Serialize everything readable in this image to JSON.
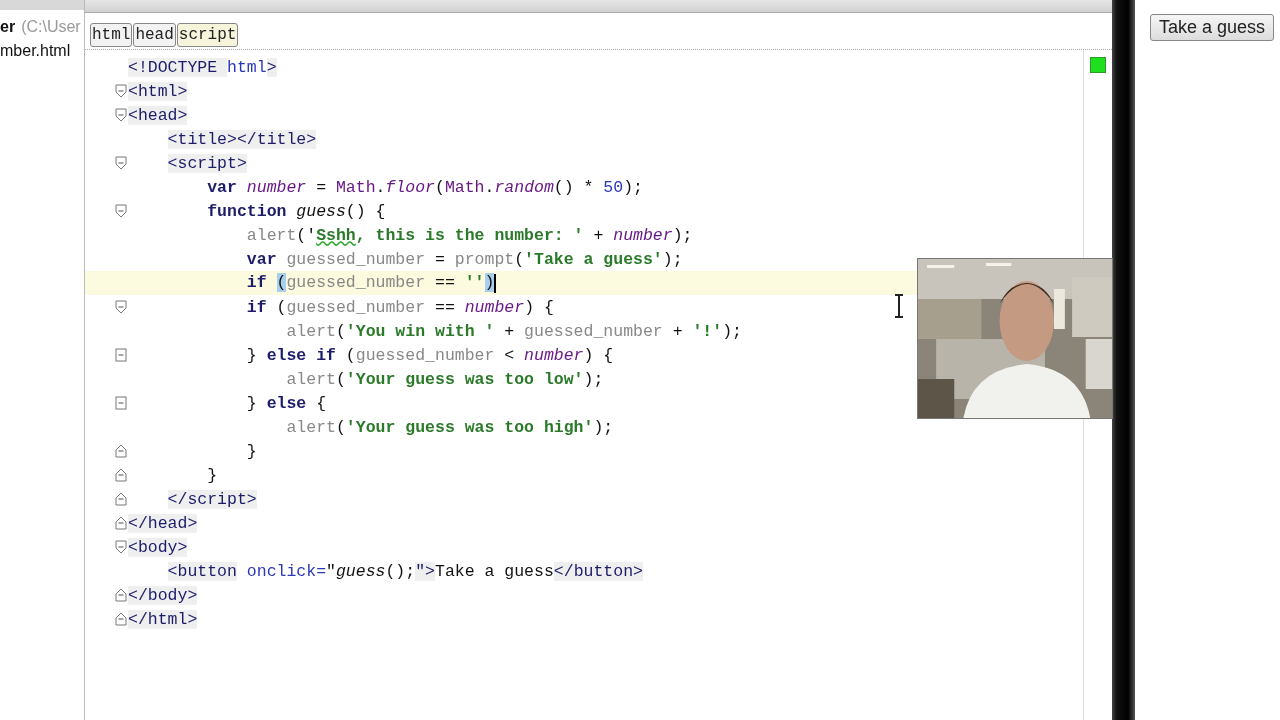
{
  "sidebar": {
    "project": {
      "name": "er",
      "path": "(C:\\User"
    },
    "files": [
      "mber.html"
    ]
  },
  "breadcrumbs": [
    {
      "label": "html",
      "selected": false
    },
    {
      "label": "head",
      "selected": false
    },
    {
      "label": "script",
      "selected": true
    }
  ],
  "code_lines": [
    {
      "tokens": [
        {
          "t": "<!DOCTYPE ",
          "kind": "tag"
        },
        {
          "t": "html",
          "kind": "attr"
        },
        {
          "t": ">",
          "kind": "tag"
        }
      ]
    },
    {
      "fold": {
        "kind": "open"
      },
      "tokens": [
        {
          "t": "<html>",
          "kind": "tag"
        }
      ]
    },
    {
      "fold": {
        "kind": "open"
      },
      "tokens": [
        {
          "t": "<head>",
          "kind": "tag"
        }
      ]
    },
    {
      "tokens": [
        {
          "t": "    <title></title>",
          "kind": "tag"
        }
      ]
    },
    {
      "fold": {
        "kind": "open"
      },
      "tokens": [
        {
          "t": "    <script>",
          "kind": "tag"
        }
      ]
    },
    {
      "tokens": [
        {
          "t": "        var ",
          "kind": "kw"
        },
        {
          "t": "number",
          "kind": "ident"
        },
        {
          "t": " = ",
          "kind": "text"
        },
        {
          "t": "Math",
          "kind": "glob"
        },
        {
          "t": ".",
          "kind": "text"
        },
        {
          "t": "floor",
          "kind": "ident"
        },
        {
          "t": "(",
          "kind": "text"
        },
        {
          "t": "Math",
          "kind": "glob"
        },
        {
          "t": ".",
          "kind": "text"
        },
        {
          "t": "random",
          "kind": "ident"
        },
        {
          "t": "() * ",
          "kind": "text"
        },
        {
          "t": "50",
          "kind": "num"
        },
        {
          "t": ");",
          "kind": "text"
        }
      ]
    },
    {
      "fold": {
        "kind": "open"
      },
      "tokens": [
        {
          "t": "        function ",
          "kind": "kw"
        },
        {
          "t": "guess",
          "kind": "fn"
        },
        {
          "t": "() {",
          "kind": "text"
        }
      ]
    },
    {
      "tokens": [
        {
          "t": "            alert",
          "kind": "call"
        },
        {
          "t": "('",
          "kind": "text"
        },
        {
          "t": "Sshh",
          "kind": "typo"
        },
        {
          "t": ", this is the number: '",
          "kind": "str"
        },
        {
          "t": " + ",
          "kind": "text"
        },
        {
          "t": "number",
          "kind": "ident"
        },
        {
          "t": ");",
          "kind": "text"
        }
      ]
    },
    {
      "tokens": [
        {
          "t": "            var ",
          "kind": "kw"
        },
        {
          "t": "guessed_number",
          "kind": "var"
        },
        {
          "t": " = ",
          "kind": "text"
        },
        {
          "t": "prompt",
          "kind": "call"
        },
        {
          "t": "(",
          "kind": "text"
        },
        {
          "t": "'Take a guess'",
          "kind": "str"
        },
        {
          "t": ");",
          "kind": "text"
        }
      ]
    },
    {
      "current": true,
      "tokens": [
        {
          "t": "            if ",
          "kind": "kw"
        },
        {
          "t": "(",
          "kind": "match"
        },
        {
          "t": "guessed_number",
          "kind": "var"
        },
        {
          "t": " == ",
          "kind": "text"
        },
        {
          "t": "''",
          "kind": "str"
        },
        {
          "t": ")",
          "kind": "match"
        }
      ]
    },
    {
      "fold": {
        "kind": "open"
      },
      "tokens": [
        {
          "t": "            if",
          "kind": "kw"
        },
        {
          "t": " (",
          "kind": "text"
        },
        {
          "t": "guessed_number",
          "kind": "var"
        },
        {
          "t": " == ",
          "kind": "text"
        },
        {
          "t": "number",
          "kind": "ident"
        },
        {
          "t": ") {",
          "kind": "text"
        }
      ]
    },
    {
      "tokens": [
        {
          "t": "                alert",
          "kind": "call"
        },
        {
          "t": "(",
          "kind": "text"
        },
        {
          "t": "'You win with '",
          "kind": "str"
        },
        {
          "t": " + ",
          "kind": "text"
        },
        {
          "t": "guessed_number",
          "kind": "var"
        },
        {
          "t": " + ",
          "kind": "text"
        },
        {
          "t": "'!'",
          "kind": "str"
        },
        {
          "t": ");",
          "kind": "text"
        }
      ]
    },
    {
      "fold": {
        "kind": "mid"
      },
      "tokens": [
        {
          "t": "            } ",
          "kind": "text"
        },
        {
          "t": "else if",
          "kind": "kw"
        },
        {
          "t": " (",
          "kind": "text"
        },
        {
          "t": "guessed_number",
          "kind": "var"
        },
        {
          "t": " < ",
          "kind": "text"
        },
        {
          "t": "number",
          "kind": "ident"
        },
        {
          "t": ") {",
          "kind": "text"
        }
      ]
    },
    {
      "tokens": [
        {
          "t": "                alert",
          "kind": "call"
        },
        {
          "t": "(",
          "kind": "text"
        },
        {
          "t": "'Your guess was too low'",
          "kind": "str"
        },
        {
          "t": ");",
          "kind": "text"
        }
      ]
    },
    {
      "fold": {
        "kind": "mid"
      },
      "tokens": [
        {
          "t": "            } ",
          "kind": "text"
        },
        {
          "t": "else",
          "kind": "kw"
        },
        {
          "t": " {",
          "kind": "text"
        }
      ]
    },
    {
      "tokens": [
        {
          "t": "                alert",
          "kind": "call"
        },
        {
          "t": "(",
          "kind": "text"
        },
        {
          "t": "'Your guess was too high'",
          "kind": "str"
        },
        {
          "t": ");",
          "kind": "text"
        }
      ]
    },
    {
      "fold": {
        "kind": "close"
      },
      "tokens": [
        {
          "t": "            }",
          "kind": "text"
        }
      ]
    },
    {
      "fold": {
        "kind": "close"
      },
      "tokens": [
        {
          "t": "        }",
          "kind": "text"
        }
      ]
    },
    {
      "fold": {
        "kind": "close"
      },
      "tokens": [
        {
          "t": "    </script>",
          "kind": "tag"
        }
      ]
    },
    {
      "fold": {
        "kind": "close"
      },
      "tokens": [
        {
          "t": "</head>",
          "kind": "tag"
        }
      ]
    },
    {
      "fold": {
        "kind": "open"
      },
      "tokens": [
        {
          "t": "<body>",
          "kind": "tag"
        }
      ]
    },
    {
      "tokens": [
        {
          "t": "    <button",
          "kind": "tag"
        },
        {
          "t": " onclick=",
          "kind": "attr"
        },
        {
          "t": "\"",
          "kind": "text"
        },
        {
          "t": "guess",
          "kind": "fn"
        },
        {
          "t": "();",
          "kind": "text"
        },
        {
          "t": "\">",
          "kind": "tag"
        },
        {
          "t": "Take a guess",
          "kind": "text"
        },
        {
          "t": "</button>",
          "kind": "tag"
        }
      ]
    },
    {
      "fold": {
        "kind": "close"
      },
      "tokens": [
        {
          "t": "</body>",
          "kind": "tag"
        }
      ]
    },
    {
      "fold": {
        "kind": "close"
      },
      "tokens": [
        {
          "t": "</html>",
          "kind": "tag"
        }
      ]
    }
  ],
  "preview": {
    "button": "Take a guess"
  }
}
